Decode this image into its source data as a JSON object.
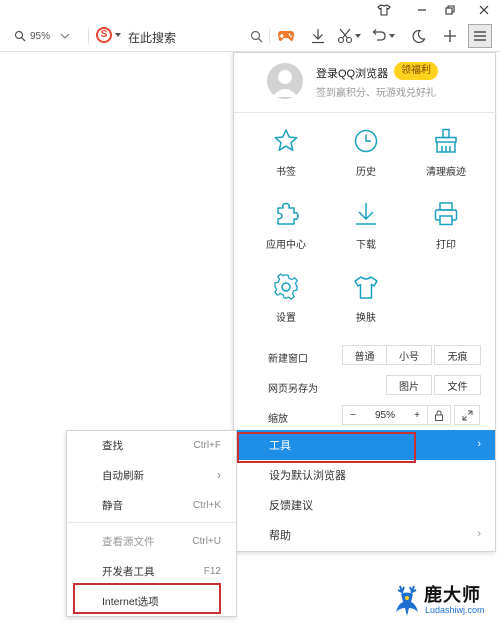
{
  "titlebar": {
    "icons": [
      "shirt-icon",
      "minimize-icon",
      "restore-icon",
      "close-icon"
    ]
  },
  "toolbar": {
    "zoom_value": "95%",
    "search_engine_initial": "S",
    "search_label": "在此搜索",
    "icons": [
      "search-icon",
      "game-controller-icon",
      "download-icon",
      "scissors-icon",
      "undo-icon",
      "moon-icon",
      "plus-icon",
      "hamburger-menu-icon"
    ]
  },
  "main_menu": {
    "login_title": "登录QQ浏览器",
    "login_badge": "领福利",
    "login_subtitle": "签到赢积分、玩游戏兑好礼",
    "grid": [
      {
        "label": "书签",
        "icon": "star-icon"
      },
      {
        "label": "历史",
        "icon": "clock-icon"
      },
      {
        "label": "清理痕迹",
        "icon": "broom-icon"
      },
      {
        "label": "应用中心",
        "icon": "puzzle-icon"
      },
      {
        "label": "下载",
        "icon": "download-icon"
      },
      {
        "label": "打印",
        "icon": "printer-icon"
      },
      {
        "label": "设置",
        "icon": "gear-icon"
      },
      {
        "label": "换肤",
        "icon": "shirt-icon"
      }
    ],
    "new_window": {
      "label": "新建窗口",
      "options": [
        "普通",
        "小号",
        "无痕"
      ]
    },
    "save_as": {
      "label": "网页另存为",
      "options": [
        "图片",
        "文件"
      ]
    },
    "zoom": {
      "label": "缩放",
      "minus": "−",
      "value": "95%",
      "plus": "+"
    },
    "items": [
      {
        "label": "工具",
        "has_submenu": true,
        "active": true
      },
      {
        "label": "设为默认浏览器",
        "has_submenu": false
      },
      {
        "label": "反馈建议",
        "has_submenu": false
      },
      {
        "label": "帮助",
        "has_submenu": true
      }
    ]
  },
  "tools_submenu": {
    "items": [
      {
        "label": "查找",
        "shortcut": "Ctrl+F"
      },
      {
        "label": "自动刷新",
        "shortcut": "›"
      },
      {
        "label": "静音",
        "shortcut": "Ctrl+K"
      },
      {
        "label": "查看源文件",
        "shortcut": "Ctrl+U",
        "disabled": true
      },
      {
        "label": "开发者工具",
        "shortcut": "F12"
      },
      {
        "label": "Internet选项",
        "shortcut": ""
      }
    ]
  },
  "watermark": {
    "title": "鹿大师",
    "url": "Ludashiwj.com"
  },
  "colors": {
    "accent": "#1e8ee6",
    "icon_teal": "#1ba0bf",
    "highlight_box": "#c83234",
    "badge": "#ffd21e"
  }
}
